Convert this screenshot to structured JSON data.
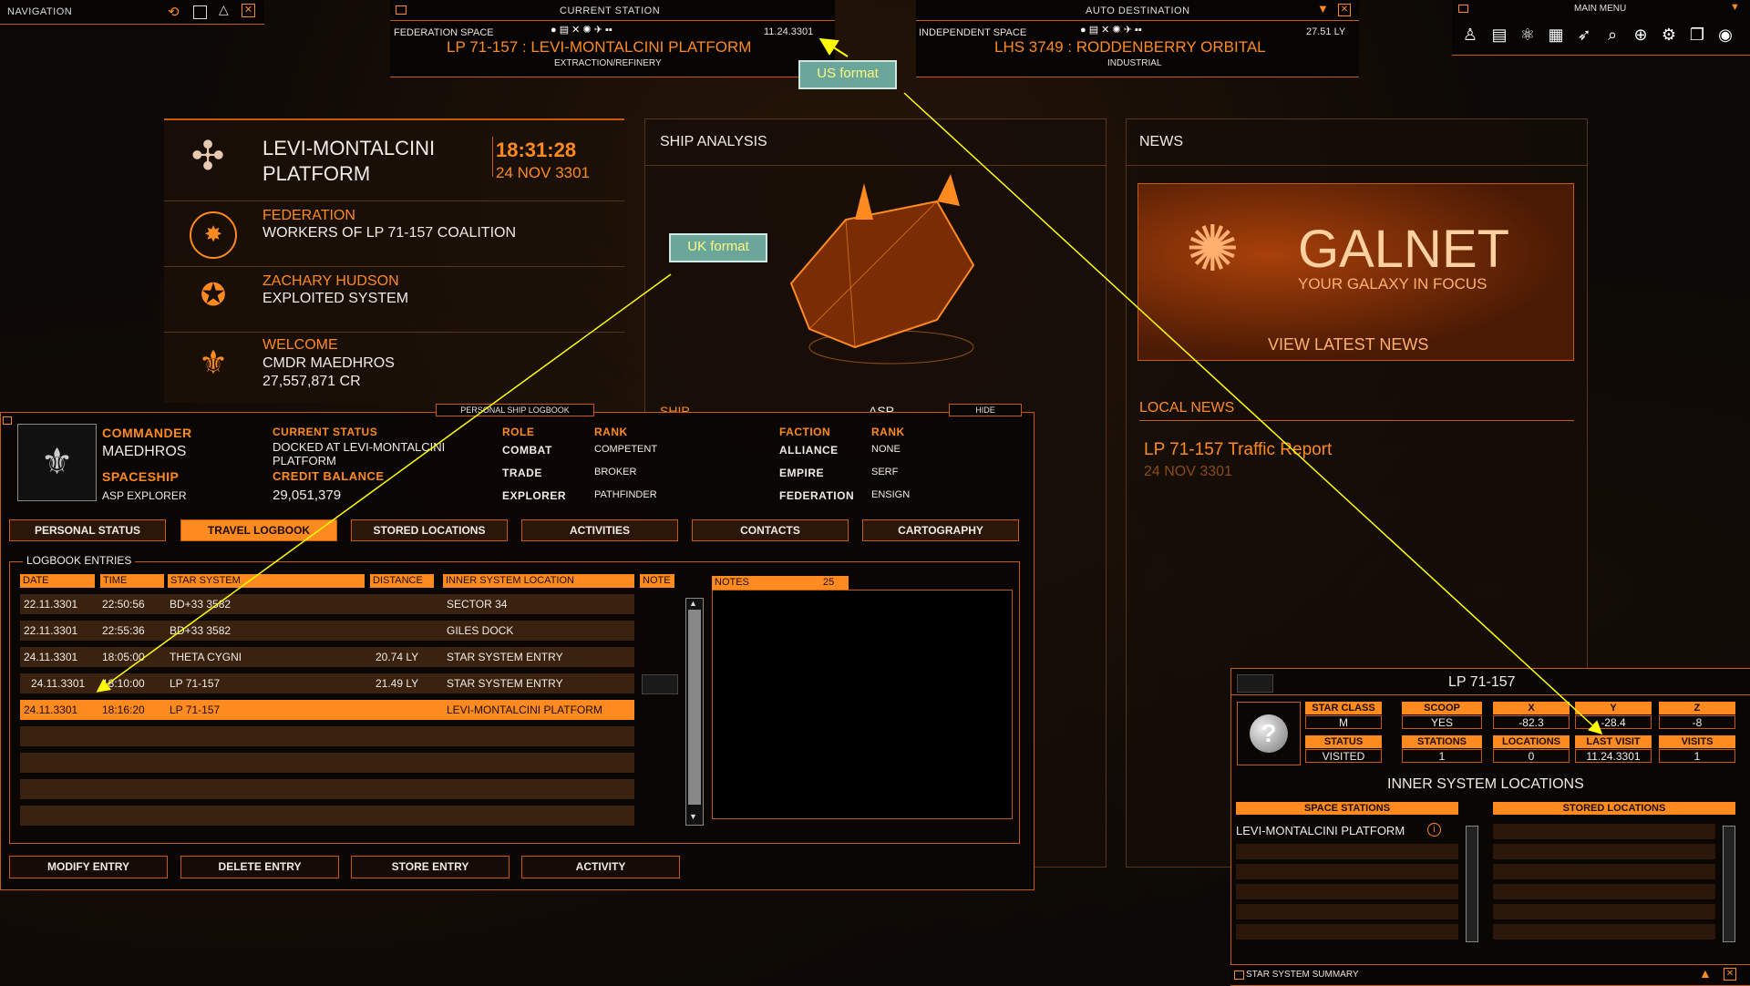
{
  "nav": {
    "title": "NAVIGATION"
  },
  "current_station": {
    "title": "CURRENT STATION",
    "space": "FEDERATION SPACE",
    "date": "11.24.3301",
    "name": "LP 71-157 : LEVI-MONTALCINI PLATFORM",
    "type": "EXTRACTION/REFINERY"
  },
  "auto_destination": {
    "title": "AUTO DESTINATION",
    "space": "INDEPENDENT SPACE",
    "distance": "27.51 LY",
    "name": "LHS 3749 : RODDENBERRY ORBITAL",
    "type": "INDUSTRIAL"
  },
  "main_menu": {
    "title": "MAIN MENU"
  },
  "callouts": {
    "us": "US format",
    "uk": "UK format"
  },
  "station_panel": {
    "name_line1": "LEVI-MONTALCINI",
    "name_line2": "PLATFORM",
    "time": "18:31:28",
    "date": "24 NOV 3301",
    "faction_label": "FEDERATION",
    "faction_value": "WORKERS OF LP 71-157 COALITION",
    "power_label": "ZACHARY HUDSON",
    "power_value": "EXPLOITED SYSTEM",
    "welcome_label": "WELCOME",
    "welcome_name": "CMDR MAEDHROS",
    "welcome_credits": "27,557,871 CR"
  },
  "ship_analysis": {
    "title": "SHIP ANALYSIS",
    "ship_label": "SHIP",
    "ship_value": "ASP"
  },
  "news": {
    "title": "NEWS",
    "galnet": "GALNET",
    "tagline": "YOUR GALAXY IN FOCUS",
    "view": "VIEW LATEST NEWS",
    "local_title": "LOCAL NEWS",
    "item_title": "LP 71-157 Traffic Report",
    "item_date": "24 NOV 3301"
  },
  "logbook": {
    "title": "PERSONAL SHIP LOGBOOK",
    "hide": "HIDE",
    "commander_label": "COMMANDER",
    "commander_name": "MAEDHROS",
    "spaceship_label": "SPACESHIP",
    "spaceship_value": "ASP EXPLORER",
    "status_label": "CURRENT STATUS",
    "status_line1": "DOCKED AT LEVI-MONTALCINI",
    "status_line2": "PLATFORM",
    "credit_label": "CREDIT BALANCE",
    "credit_value": "29,051,379",
    "role_hdr": "ROLE",
    "rank_hdr": "RANK",
    "faction_hdr": "FACTION",
    "rank_hdr2": "RANK",
    "roles": [
      {
        "role": "COMBAT",
        "rank": "COMPETENT"
      },
      {
        "role": "TRADE",
        "rank": "BROKER"
      },
      {
        "role": "EXPLORER",
        "rank": "PATHFINDER"
      }
    ],
    "factions": [
      {
        "faction": "ALLIANCE",
        "rank": "NONE"
      },
      {
        "faction": "EMPIRE",
        "rank": "SERF"
      },
      {
        "faction": "FEDERATION",
        "rank": "ENSIGN"
      }
    ],
    "tabs": [
      "PERSONAL STATUS",
      "TRAVEL LOGBOOK",
      "STORED LOCATIONS",
      "ACTIVITIES",
      "CONTACTS",
      "CARTOGRAPHY"
    ],
    "entries_title": "LOGBOOK ENTRIES",
    "columns": [
      "DATE",
      "TIME",
      "STAR SYSTEM",
      "DISTANCE",
      "INNER SYSTEM LOCATION",
      "NOTE"
    ],
    "entries": [
      {
        "date": "22.11.3301",
        "time": "22:50:56",
        "system": "BD+33 3582",
        "distance": "",
        "location": "SECTOR 34"
      },
      {
        "date": "22.11.3301",
        "time": "22:55:36",
        "system": "BD+33 3582",
        "distance": "",
        "location": "GILES DOCK"
      },
      {
        "date": "24.11.3301",
        "time": "18:05:00",
        "system": "THETA CYGNI",
        "distance": "20.74 LY",
        "location": "STAR SYSTEM ENTRY"
      },
      {
        "date": "24.11.3301",
        "time": "18:10:00",
        "system": "LP 71-157",
        "distance": "21.49 LY",
        "location": "STAR SYSTEM ENTRY"
      },
      {
        "date": "24.11.3301",
        "time": "18:16:20",
        "system": "LP 71-157",
        "distance": "",
        "location": "LEVI-MONTALCINI PLATFORM"
      }
    ],
    "notes_label": "NOTES",
    "notes_count": "25",
    "buttons": [
      "MODIFY ENTRY",
      "DELETE ENTRY",
      "STORE ENTRY",
      "ACTIVITY"
    ]
  },
  "system_summary": {
    "system": "LP 71-157",
    "headers1": [
      "STAR CLASS",
      "SCOOP",
      "X",
      "Y",
      "Z"
    ],
    "values1": [
      "M",
      "YES",
      "-82.3",
      "-28.4",
      "-8"
    ],
    "headers2": [
      "STATUS",
      "STATIONS",
      "LOCATIONS",
      "LAST VISIT",
      "VISITS"
    ],
    "values2": [
      "VISITED",
      "1",
      "0",
      "11.24.3301",
      "1"
    ],
    "inner_title": "INNER SYSTEM LOCATIONS",
    "col_space": "SPACE STATIONS",
    "col_stored": "STORED LOCATIONS",
    "station_item": "LEVI-MONTALCINI PLATFORM",
    "footer": "STAR SYSTEM SUMMARY"
  },
  "colors": {
    "accent": "#ff8a1f",
    "callout_bg": "#6aa79a",
    "callout_text": "#fffb80",
    "arrow": "#ffff00"
  }
}
